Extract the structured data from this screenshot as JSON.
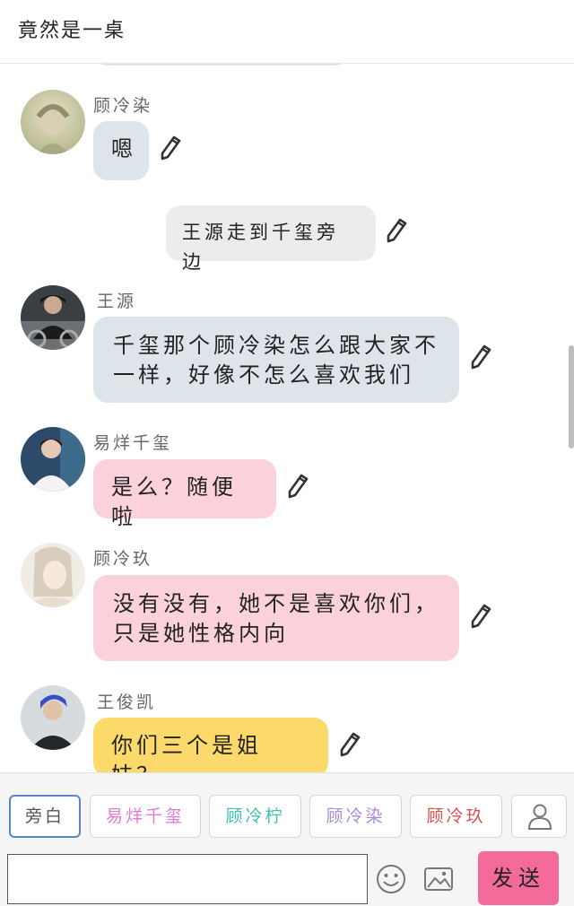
{
  "header": {
    "title": "竟然是一桌"
  },
  "messages": [
    {
      "sender": "顾冷染",
      "text": "嗯",
      "color": "#dde5eb"
    },
    {
      "narration": "王源走到千玺旁边",
      "color": "#ececec"
    },
    {
      "sender": "王源",
      "text_lines": [
        "千玺那个顾冷染怎么跟大家不",
        "一样，好像不怎么喜欢我们"
      ],
      "color": "#dde5eb"
    },
    {
      "sender": "易烊千玺",
      "text": "是么？随便啦",
      "color": "#fbd1dc"
    },
    {
      "sender": "顾冷玖",
      "text_lines": [
        "没有没有，她不是喜欢你们，",
        "只是她性格内向"
      ],
      "color": "#fbd1dc"
    },
    {
      "sender": "王俊凯",
      "text": "你们三个是姐妹？",
      "color": "#fbd96a"
    }
  ],
  "roles": [
    {
      "label": "旁白",
      "color": "#555555",
      "active": true
    },
    {
      "label": "易烊千玺",
      "color": "#e07ad6"
    },
    {
      "label": "顾冷柠",
      "color": "#3cc1b5"
    },
    {
      "label": "顾冷染",
      "color": "#a88ad8"
    },
    {
      "label": "顾冷玖",
      "color": "#d9534f"
    }
  ],
  "input": {
    "value": "",
    "placeholder": ""
  },
  "send": {
    "label": "发送"
  },
  "icons": {
    "edit": "pencil-icon",
    "emoji": "smiley-icon",
    "image": "image-icon",
    "person": "person-icon"
  }
}
